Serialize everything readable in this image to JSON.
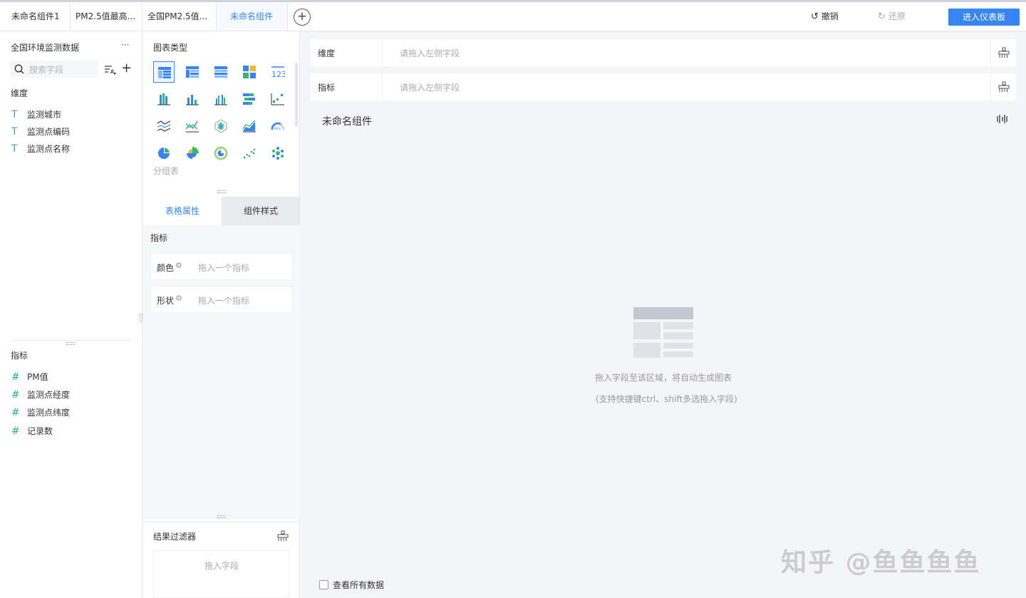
{
  "tabs": [
    {
      "label": "未命名组件1"
    },
    {
      "label": "PM2.5值最高..."
    },
    {
      "label": "全国PM2.5值..."
    },
    {
      "label": "未命名组件"
    }
  ],
  "toolbar": {
    "undo": "撤销",
    "redo": "还原",
    "enter_dashboard": "进入仪表板"
  },
  "left_panel": {
    "dataset": "全国环境监测数据",
    "more": "···",
    "search_placeholder": "搜索字段",
    "dimension_title": "维度",
    "dimensions": [
      {
        "label": "监测城市",
        "icon": "T"
      },
      {
        "label": "监测点编码",
        "icon": "T"
      },
      {
        "label": "监测点名称",
        "icon": "T"
      }
    ],
    "measure_title": "指标",
    "measures": [
      {
        "label": "PM值",
        "icon": "#"
      },
      {
        "label": "监测点经度",
        "icon": "#"
      },
      {
        "label": "监测点纬度",
        "icon": "#"
      },
      {
        "label": "记录数",
        "icon": "#"
      }
    ]
  },
  "mid_panel": {
    "chart_type_title": "图表类型",
    "chart_icons": [
      "group-table",
      "cross-table",
      "detail-table",
      "heatmap-table",
      "kpi-card",
      "stacked-bar",
      "bar",
      "grouped-bar",
      "ranged-bar",
      "scatter-bar",
      "multi-line",
      "line",
      "radar",
      "area",
      "gauge",
      "pie",
      "rose-pie",
      "ring-pie",
      "scatter",
      "bubble"
    ],
    "selected_hint": "分组表",
    "sub_tab_active": "表格属性",
    "sub_tab_other": "组件样式",
    "measure_section": "指标",
    "color_label": "颜色",
    "color_placeholder": "拖入一个指标",
    "shape_label": "形状",
    "shape_placeholder": "拖入一个指标",
    "filter_title": "结果过滤器",
    "filter_placeholder": "拖入字段"
  },
  "main": {
    "dimension_label": "维度",
    "dimension_placeholder": "请拖入左侧字段",
    "measure_label": "指标",
    "measure_placeholder": "请拖入左侧字段",
    "component_title": "未命名组件",
    "empty_line1": "拖入字段至该区域，将自动生成图表",
    "empty_line2": "(支持快捷键ctrl、shift多选拖入字段)",
    "view_all": "查看所有数据"
  },
  "watermark": "知乎 @鱼鱼鱼鱼",
  "colors": {
    "accent": "#3685f2",
    "field_icon": "#4fa3a6"
  }
}
